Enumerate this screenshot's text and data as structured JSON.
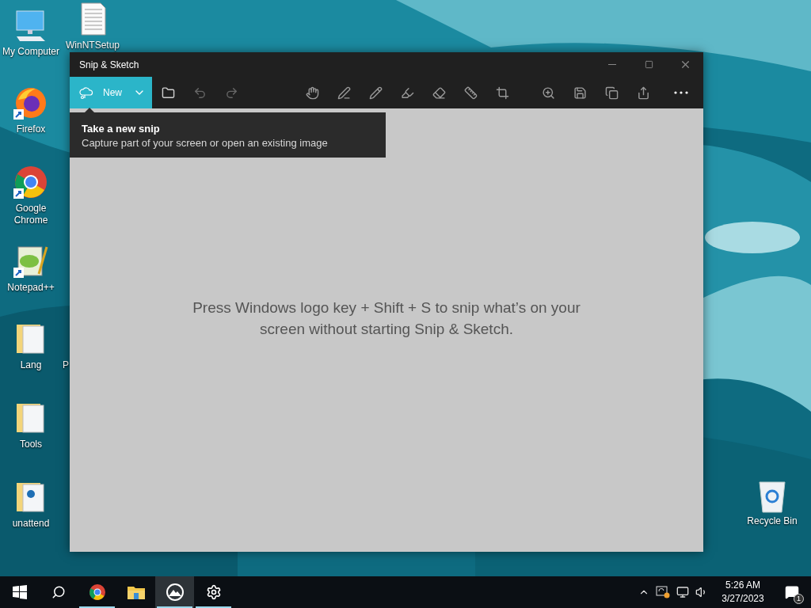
{
  "desktop": {
    "icons": [
      {
        "label": "My Computer",
        "kind": "computer"
      },
      {
        "label": "WinNTSetup",
        "kind": "document"
      },
      {
        "label": "Firefox",
        "kind": "firefox",
        "shortcut": true
      },
      {
        "label": "Google Chrome",
        "kind": "chrome",
        "shortcut": true
      },
      {
        "label": "Notepad++",
        "kind": "notepad",
        "shortcut": true
      },
      {
        "label": "Lang",
        "kind": "folder"
      },
      {
        "label": "P",
        "kind": "hidden"
      },
      {
        "label": "Tools",
        "kind": "folder"
      },
      {
        "label": "unattend",
        "kind": "docfolder"
      },
      {
        "label": "Recycle Bin",
        "kind": "recycle"
      }
    ]
  },
  "window": {
    "title": "Snip & Sketch",
    "new_button": {
      "label": "New"
    },
    "tooltip": {
      "title": "Take a new snip",
      "text": "Capture part of your screen or open an existing image"
    },
    "hint": "Press Windows logo key + Shift + S to snip what’s on your screen without starting Snip & Sketch."
  },
  "taskbar": {
    "items": [
      {
        "kind": "start",
        "selected": false,
        "running": false
      },
      {
        "kind": "search",
        "selected": false,
        "running": false
      },
      {
        "kind": "chrome",
        "selected": false,
        "running": true
      },
      {
        "kind": "explorer",
        "selected": false,
        "running": false
      },
      {
        "kind": "snip",
        "selected": true,
        "running": true
      },
      {
        "kind": "settings",
        "selected": false,
        "running": true
      }
    ],
    "clock": {
      "time": "5:26 AM",
      "date": "3/27/2023"
    },
    "notifications": {
      "count": "1"
    }
  }
}
